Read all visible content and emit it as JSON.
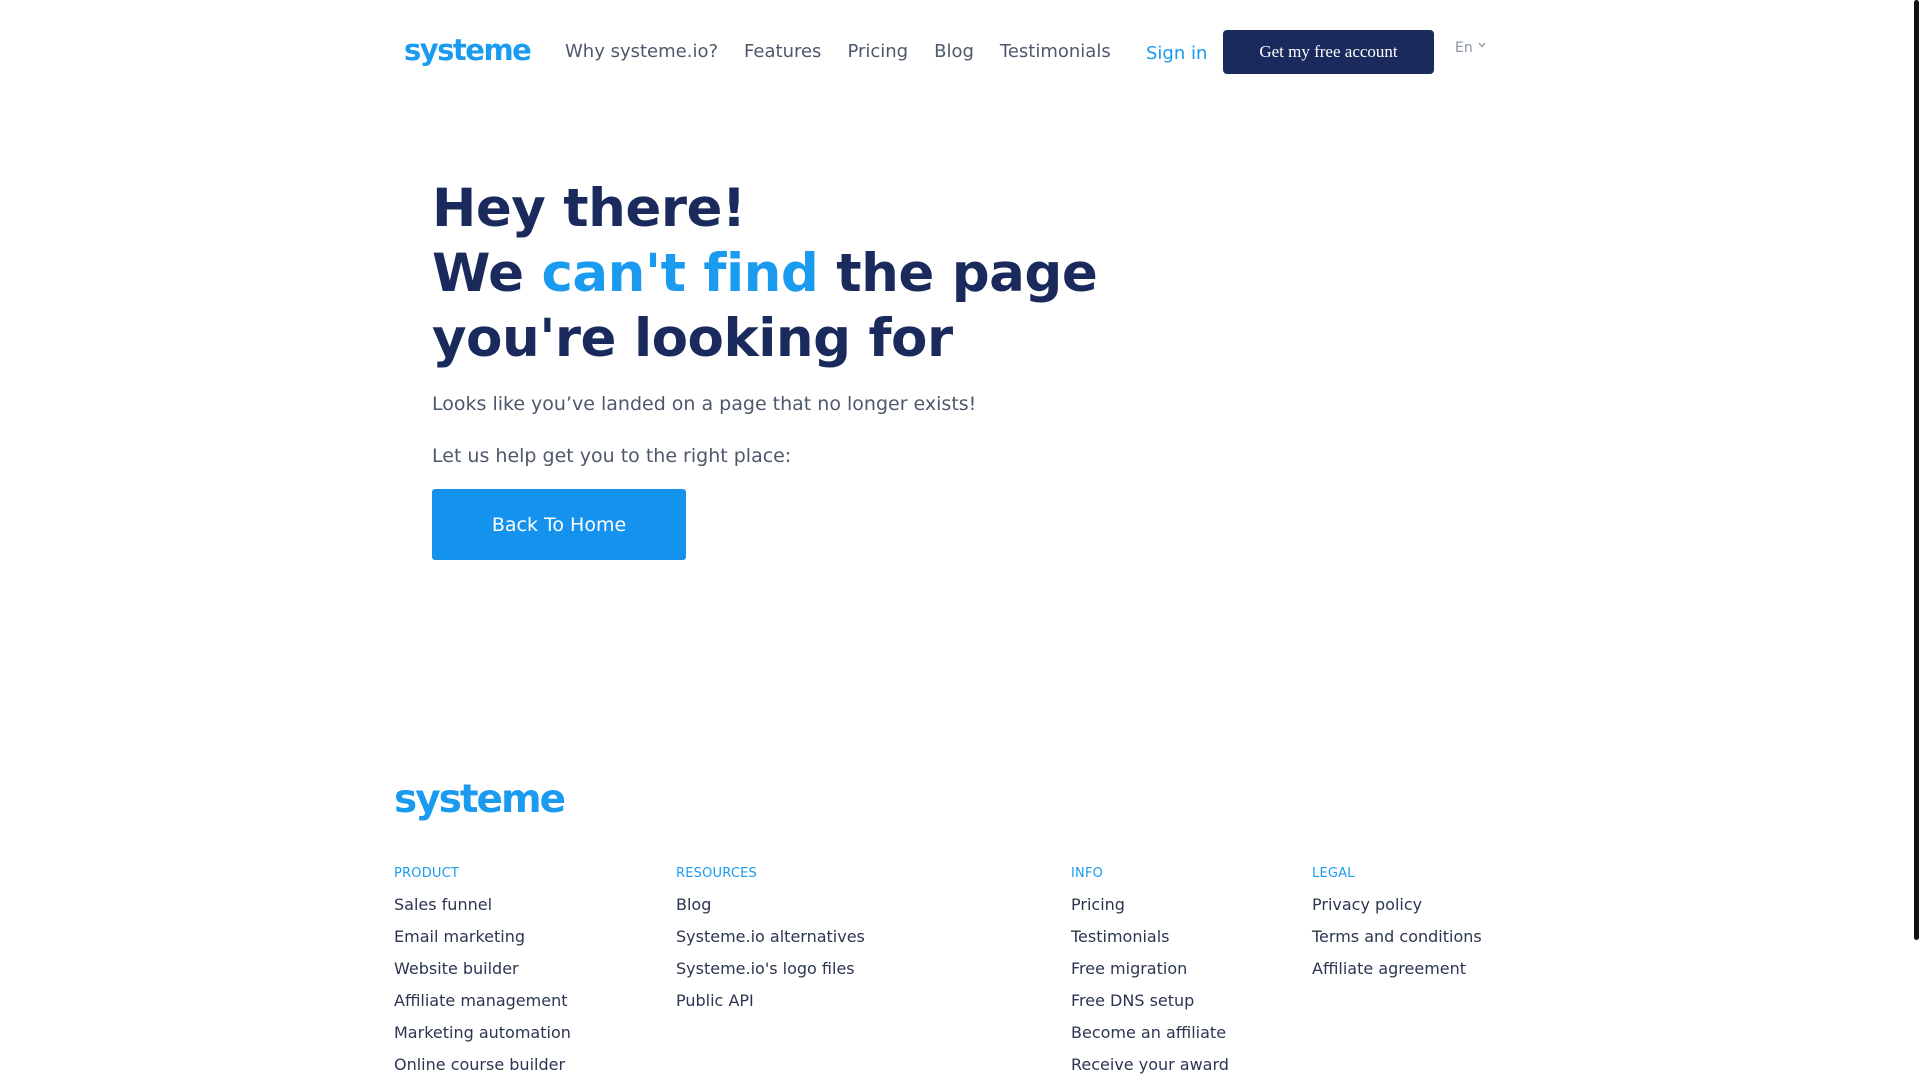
{
  "header": {
    "logo": "systeme",
    "nav": [
      {
        "label": "Why systeme.io?"
      },
      {
        "label": "Features"
      },
      {
        "label": "Pricing"
      },
      {
        "label": "Blog"
      },
      {
        "label": "Testimonials"
      }
    ],
    "signin_label": "Sign in",
    "cta_label": "Get my free account",
    "language": "En"
  },
  "hero": {
    "line1": "Hey there!",
    "line2_pre": "We ",
    "line2_accent": "can't find",
    "line2_post": " the page",
    "line3": "you're looking for",
    "lead": "Looks like you’ve landed on a page that no longer exists!",
    "help": "Let us help get you to the right place:",
    "back_button": "Back To Home"
  },
  "footer": {
    "logo": "systeme",
    "columns": [
      {
        "heading": "PRODUCT",
        "links": [
          "Sales funnel",
          "Email marketing",
          "Website builder",
          "Affiliate management",
          "Marketing automation",
          "Online course builder"
        ]
      },
      {
        "heading": "RESOURCES",
        "links": [
          "Blog",
          "Systeme.io alternatives",
          "Systeme.io's logo files",
          "Public API"
        ]
      },
      {
        "heading": "INFO",
        "links": [
          "Pricing",
          "Testimonials",
          "Free migration",
          "Free DNS setup",
          "Become an affiliate",
          "Receive your award"
        ]
      },
      {
        "heading": "LEGAL",
        "links": [
          "Privacy policy",
          "Terms and conditions",
          "Affiliate agreement"
        ]
      }
    ]
  },
  "colors": {
    "brand_blue": "#1a9bf0",
    "navy": "#1a2a5c",
    "button_blue": "#1592ee"
  }
}
